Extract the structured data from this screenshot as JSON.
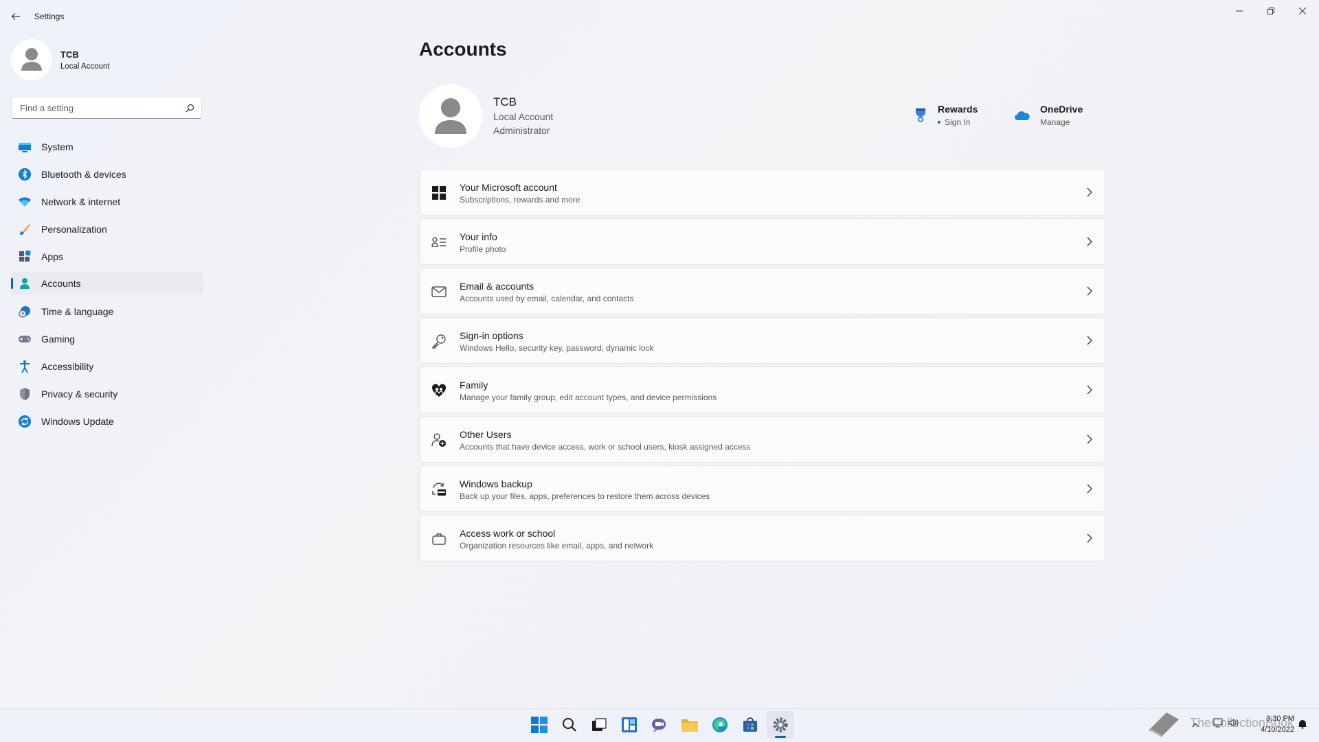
{
  "window": {
    "title": "Settings"
  },
  "sidebar": {
    "profile": {
      "name": "TCB",
      "type": "Local Account"
    },
    "search": {
      "placeholder": "Find a setting"
    },
    "items": [
      {
        "label": "System",
        "icon": "display-icon"
      },
      {
        "label": "Bluetooth & devices",
        "icon": "bluetooth-icon"
      },
      {
        "label": "Network & internet",
        "icon": "wifi-icon"
      },
      {
        "label": "Personalization",
        "icon": "brush-icon"
      },
      {
        "label": "Apps",
        "icon": "apps-icon"
      },
      {
        "label": "Accounts",
        "icon": "person-icon",
        "selected": true
      },
      {
        "label": "Time & language",
        "icon": "globe-clock-icon"
      },
      {
        "label": "Gaming",
        "icon": "gamepad-icon"
      },
      {
        "label": "Accessibility",
        "icon": "accessibility-icon"
      },
      {
        "label": "Privacy & security",
        "icon": "shield-icon"
      },
      {
        "label": "Windows Update",
        "icon": "update-icon"
      }
    ]
  },
  "main": {
    "title": "Accounts",
    "user": {
      "name": "TCB",
      "type": "Local Account",
      "role": "Administrator"
    },
    "services": [
      {
        "name": "Rewards",
        "sub": "Sign In",
        "icon": "rewards-trophy-icon"
      },
      {
        "name": "OneDrive",
        "sub": "Manage",
        "icon": "onedrive-cloud-icon"
      }
    ],
    "rows": [
      {
        "title": "Your Microsoft account",
        "sub": "Subscriptions, rewards and more",
        "icon": "windows-logo-icon"
      },
      {
        "title": "Your info",
        "sub": "Profile photo",
        "icon": "contact-card-icon"
      },
      {
        "title": "Email & accounts",
        "sub": "Accounts used by email, calendar, and contacts",
        "icon": "mail-icon"
      },
      {
        "title": "Sign-in options",
        "sub": "Windows Hello, security key, password, dynamic lock",
        "icon": "key-icon"
      },
      {
        "title": "Family",
        "sub": "Manage your family group, edit account types, and device permissions",
        "icon": "family-heart-icon"
      },
      {
        "title": "Other Users",
        "sub": "Accounts that have device access, work or school users, kiosk assigned access",
        "icon": "person-add-icon"
      },
      {
        "title": "Windows backup",
        "sub": "Back up your files, apps, preferences to restore them across devices",
        "icon": "backup-icon"
      },
      {
        "title": "Access work or school",
        "sub": "Organization resources like email, apps, and network",
        "icon": "briefcase-icon"
      }
    ]
  },
  "taskbar": {
    "apps": [
      "start-icon",
      "search-icon",
      "task-view-icon",
      "widgets-icon",
      "chat-icon",
      "file-explorer-icon",
      "edge-icon",
      "store-icon",
      "settings-icon"
    ],
    "active": "settings-icon",
    "clock": {
      "time": "3:30 PM",
      "date": "4/10/2022"
    },
    "watermark": "TheCollectionBook"
  },
  "colors": {
    "accent": "#0067c0",
    "background": "#f3f3f3",
    "card": "#fbfbfb"
  }
}
